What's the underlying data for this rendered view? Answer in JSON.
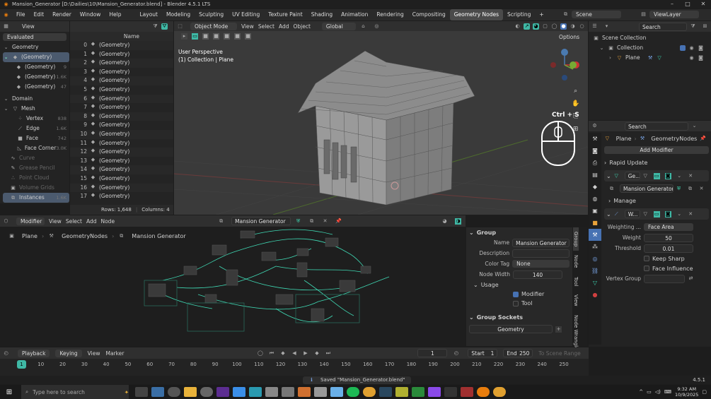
{
  "window": {
    "title": "Mansion_Generator [D:\\Dailies\\10\\Mansion_Generator.blend] - Blender 4.5.1 LTS"
  },
  "menu": [
    "File",
    "Edit",
    "Render",
    "Window",
    "Help"
  ],
  "workspaces": [
    "Layout",
    "Modeling",
    "Sculpting",
    "UV Editing",
    "Texture Paint",
    "Shading",
    "Animation",
    "Rendering",
    "Compositing",
    "Geometry Nodes",
    "Scripting",
    "+"
  ],
  "active_workspace": "Geometry Nodes",
  "top_right": {
    "scene": "Scene",
    "view_layer": "ViewLayer"
  },
  "spreadsheet": {
    "view_label": "View",
    "evaluated": "Evaluated",
    "col_name": "Name",
    "tree": [
      {
        "label": "Geometry",
        "count": ""
      },
      {
        "label": "(Geometry)",
        "count": ""
      },
      {
        "label": "(Geometry)",
        "count": "9"
      },
      {
        "label": "(Geometry)",
        "count": "1.6K"
      },
      {
        "label": "(Geometry)",
        "count": "47"
      },
      {
        "label": "Domain",
        "count": ""
      },
      {
        "label": "Mesh",
        "count": ""
      },
      {
        "label": "Vertex",
        "count": "838"
      },
      {
        "label": "Edge",
        "count": "1.6K"
      },
      {
        "label": "Face",
        "count": "742"
      },
      {
        "label": "Face Corner",
        "count": "3.0K"
      },
      {
        "label": "Curve",
        "count": ""
      },
      {
        "label": "Grease Pencil",
        "count": ""
      },
      {
        "label": "Point Cloud",
        "count": ""
      },
      {
        "label": "Volume Grids",
        "count": ""
      },
      {
        "label": "Instances",
        "count": "1.6K"
      }
    ],
    "rows": [
      {
        "i": "0",
        "v": "(Geometry)"
      },
      {
        "i": "1",
        "v": "(Geometry)"
      },
      {
        "i": "2",
        "v": "(Geometry)"
      },
      {
        "i": "3",
        "v": "(Geometry)"
      },
      {
        "i": "4",
        "v": "(Geometry)"
      },
      {
        "i": "5",
        "v": "(Geometry)"
      },
      {
        "i": "6",
        "v": "(Geometry)"
      },
      {
        "i": "7",
        "v": "(Geometry)"
      },
      {
        "i": "8",
        "v": "(Geometry)"
      },
      {
        "i": "9",
        "v": "(Geometry)"
      },
      {
        "i": "10",
        "v": "(Geometry)"
      },
      {
        "i": "11",
        "v": "(Geometry)"
      },
      {
        "i": "12",
        "v": "(Geometry)"
      },
      {
        "i": "13",
        "v": "(Geometry)"
      },
      {
        "i": "14",
        "v": "(Geometry)"
      },
      {
        "i": "15",
        "v": "(Geometry)"
      },
      {
        "i": "16",
        "v": "(Geometry)"
      },
      {
        "i": "17",
        "v": "(Geometry)"
      }
    ],
    "footer_rows": "Rows: 1,648",
    "footer_cols": "Columns: 4"
  },
  "viewport": {
    "mode": "Object Mode",
    "menus": [
      "View",
      "Select",
      "Add",
      "Object"
    ],
    "orientation": "Global",
    "options": "Options",
    "overlay_title": "User Perspective",
    "overlay_sub": "(1) Collection | Plane",
    "shortcut": "Ctrl + S"
  },
  "outliner": {
    "search": "Search",
    "scene_collection": "Scene Collection",
    "collection": "Collection",
    "plane": "Plane"
  },
  "properties": {
    "search": "Search",
    "crumb_obj": "Plane",
    "crumb_mod": "GeometryNodes",
    "add_modifier": "Add Modifier",
    "rapid_update": "Rapid Update",
    "mod1_name": "Ge...",
    "mod1_group": "Mansion Generator",
    "manage": "Manage",
    "mod2_name": "W...",
    "weighting_label": "Weighting ...",
    "weighting_value": "Face Area",
    "weight_label": "Weight",
    "weight_value": "50",
    "threshold_label": "Threshold",
    "threshold_value": "0.01",
    "keep_sharp": "Keep Sharp",
    "face_influence": "Face Influence",
    "vertex_group": "Vertex Group"
  },
  "node_editor": {
    "editor_type": "Modifier",
    "menus": [
      "View",
      "Select",
      "Add",
      "Node"
    ],
    "group_name": "Mansion Generator",
    "crumb": [
      "Plane",
      "GeometryNodes",
      "Mansion Generator"
    ]
  },
  "sidebar": {
    "group_header": "Group",
    "name_label": "Name",
    "name_value": "Mansion Generator",
    "desc_label": "Description",
    "color_label": "Color Tag",
    "color_value": "None",
    "width_label": "Node Width",
    "width_value": "140",
    "usage_header": "Usage",
    "modifier_label": "Modifier",
    "tool_label": "Tool",
    "sockets_header": "Group Sockets",
    "socket_name": "Geometry",
    "tabs": [
      "Group",
      "Node",
      "Tool",
      "View",
      "Node Wrangler"
    ]
  },
  "timeline": {
    "menus": [
      "Playback",
      "Keying",
      "View",
      "Marker"
    ],
    "current_frame": "1",
    "start_label": "Start",
    "start": "1",
    "end_label": "End",
    "end": "250",
    "to_scene": "To Scene Range",
    "ticks": [
      "1",
      "10",
      "20",
      "30",
      "40",
      "50",
      "60",
      "70",
      "80",
      "90",
      "100",
      "110",
      "120",
      "130",
      "140",
      "150",
      "160",
      "170",
      "180",
      "190",
      "200",
      "210",
      "220",
      "230",
      "240",
      "250"
    ]
  },
  "status": {
    "message": "Saved \"Mansion_Generator.blend\"",
    "version": "4.5.1"
  },
  "taskbar": {
    "search": "Type here to search",
    "time": "9:32 AM",
    "date": "10/9/2025"
  },
  "colors": {
    "accent": "#4772b3",
    "node_link": "#3fd9b4",
    "active_ws": "#4a4a4a",
    "frame": "#3fb8a5"
  }
}
